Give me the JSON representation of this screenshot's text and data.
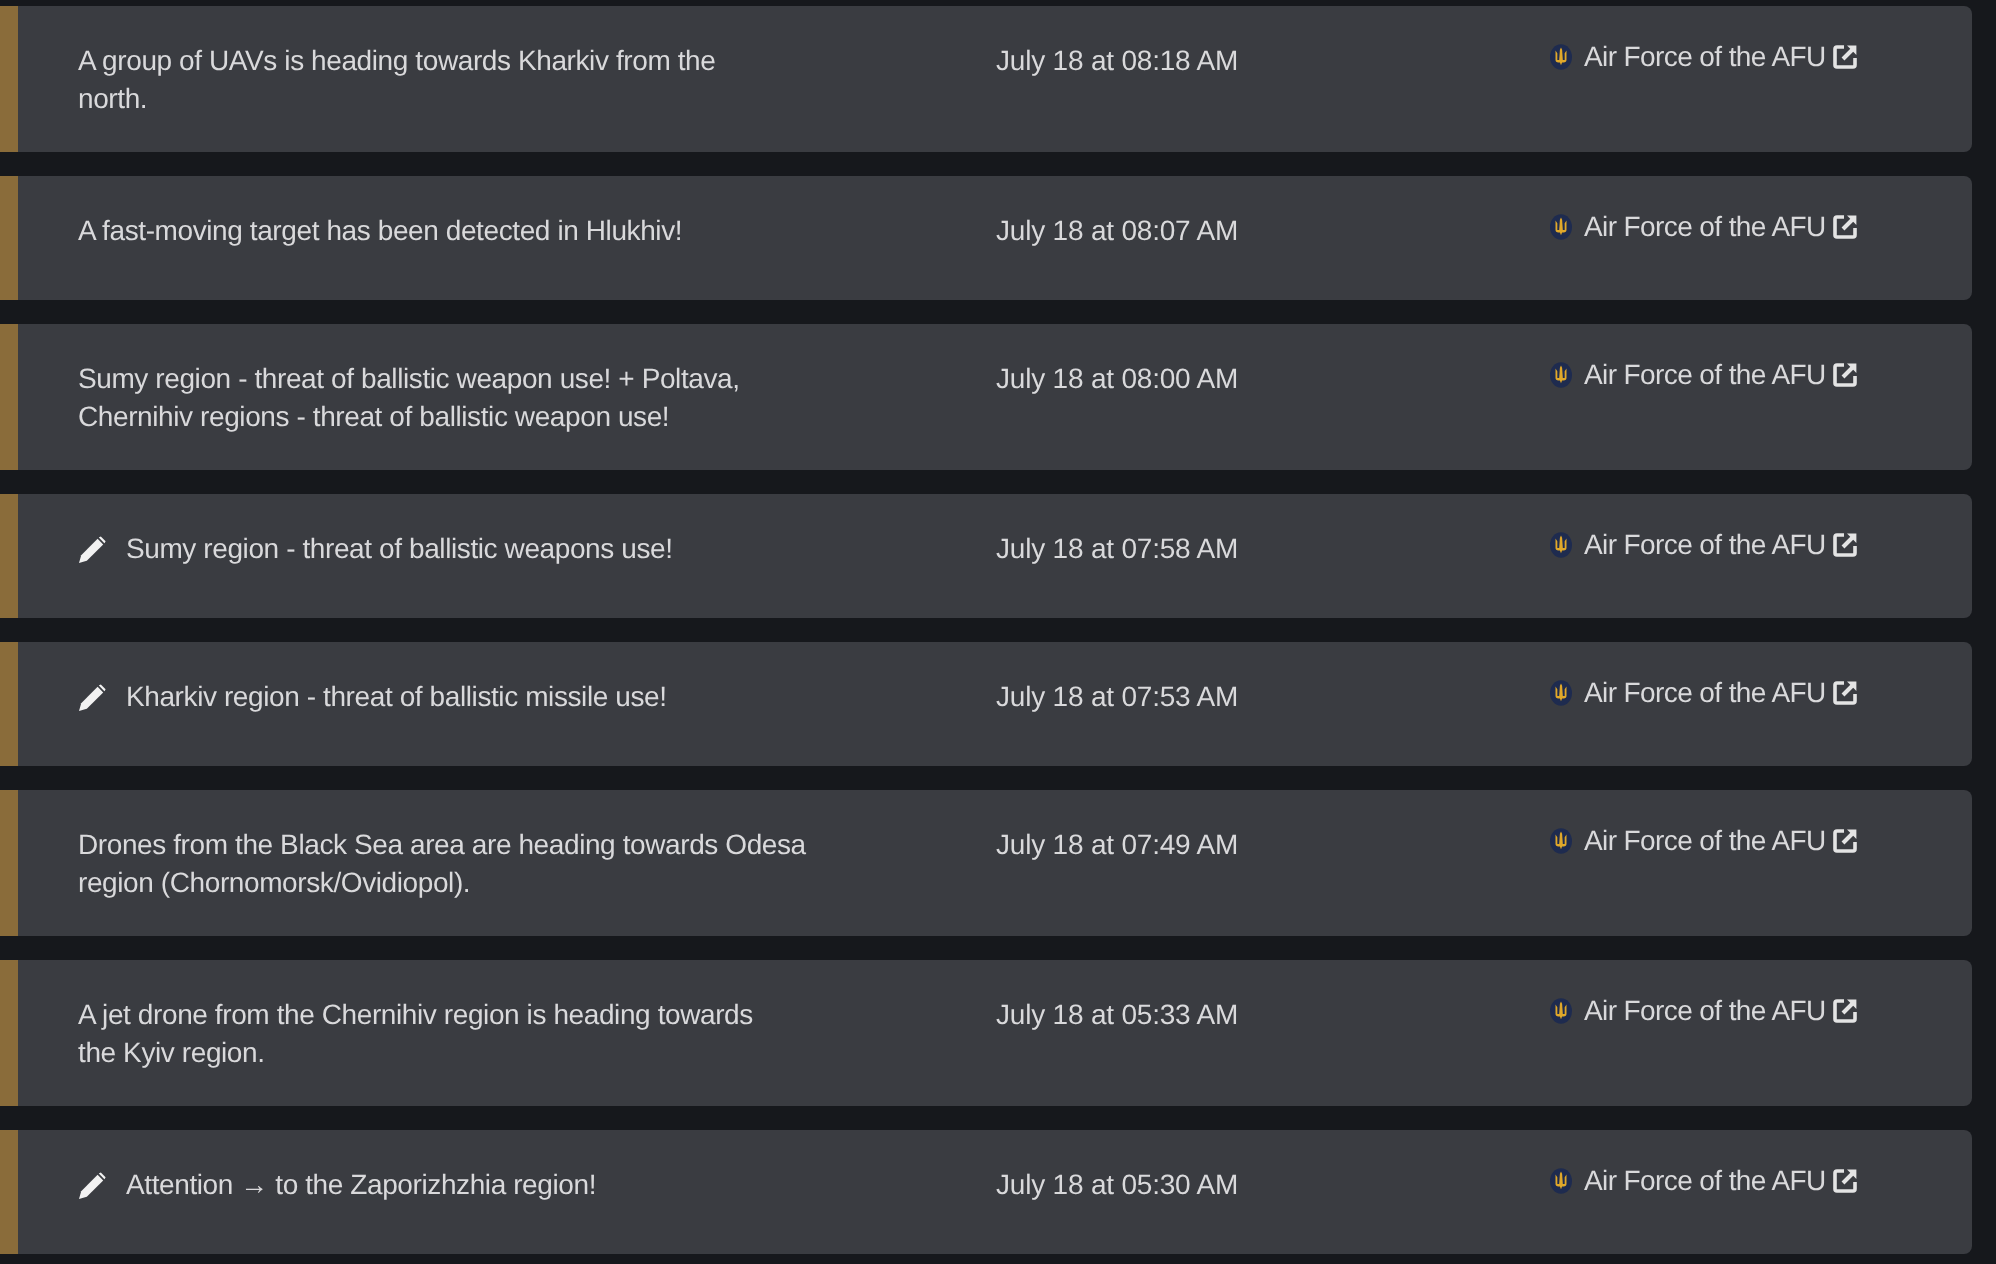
{
  "alerts": [
    {
      "message": "A group of UAVs is heading towards Kharkiv from the\nnorth.",
      "edited": false,
      "time": "July 18 at 08:18 AM",
      "source": "Air Force of the AFU"
    },
    {
      "message": "A fast-moving target has been detected in Hlukhiv!",
      "edited": false,
      "time": "July 18 at 08:07 AM",
      "source": "Air Force of the AFU"
    },
    {
      "message": "Sumy region - threat of ballistic weapon use! + Poltava,\nChernihiv regions - threat of ballistic weapon use!",
      "edited": false,
      "time": "July 18 at 08:00 AM",
      "source": "Air Force of the AFU"
    },
    {
      "message": "Sumy region - threat of ballistic weapons use!",
      "edited": true,
      "time": "July 18 at 07:58 AM",
      "source": "Air Force of the AFU"
    },
    {
      "message": "Kharkiv region - threat of ballistic missile use!",
      "edited": true,
      "time": "July 18 at 07:53 AM",
      "source": "Air Force of the AFU"
    },
    {
      "message": "Drones from the Black Sea area are heading towards Odesa\nregion (Chornomorsk/Ovidiopol).",
      "edited": false,
      "time": "July 18 at 07:49 AM",
      "source": "Air Force of the AFU"
    },
    {
      "message": "A jet drone from the Chernihiv region is heading towards\nthe Kyiv region.",
      "edited": false,
      "time": "July 18 at 05:33 AM",
      "source": "Air Force of the AFU"
    },
    {
      "message": "Attention → to the Zaporizhzhia region!",
      "edited": true,
      "time": "July 18 at 05:30 AM",
      "source": "Air Force of the AFU"
    }
  ]
}
